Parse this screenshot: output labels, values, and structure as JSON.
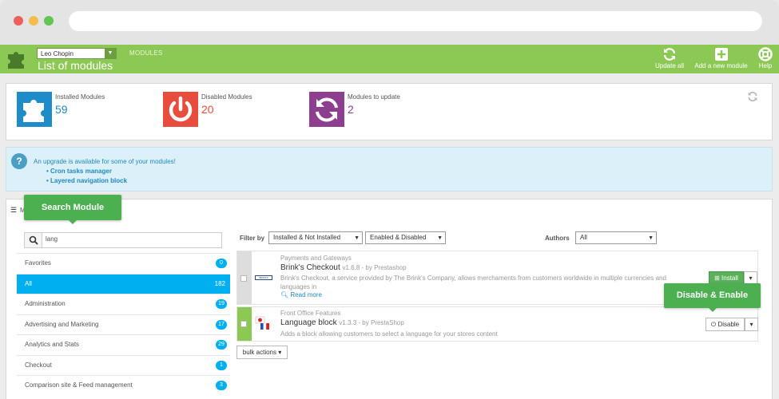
{
  "header": {
    "shop": "Leo Chopin",
    "breadcrumb": "MODULES",
    "title": "List of modules",
    "update_all": "Update all",
    "add_module": "Add a new module",
    "help": "Help"
  },
  "stats": [
    {
      "label": "Installed Modules",
      "value": "59",
      "color": "#1d8cc8"
    },
    {
      "label": "Disabled Modules",
      "value": "20",
      "color": "#e84c3d"
    },
    {
      "label": "Modules to update",
      "value": "2",
      "color": "#8e3e8e"
    }
  ],
  "alert": {
    "message": "An upgrade is available for some of your modules!",
    "items": [
      "Cron tasks manager",
      "Layered navigation block"
    ]
  },
  "tooltips": {
    "search": "Search Module",
    "disable_enable": "Disable & Enable"
  },
  "panel_heading": "M",
  "search": {
    "value": "lang"
  },
  "categories": [
    {
      "name": "Favorites",
      "count": "0"
    },
    {
      "name": "All",
      "count": "182"
    },
    {
      "name": "Administration",
      "count": "19"
    },
    {
      "name": "Advertising and Marketing",
      "count": "17"
    },
    {
      "name": "Analytics and Stats",
      "count": "29"
    },
    {
      "name": "Checkout",
      "count": "1"
    },
    {
      "name": "Comparison site & Feed management",
      "count": "3"
    }
  ],
  "filters": {
    "filter_by": "Filter by",
    "install_state": "Installed & Not Installed",
    "enable_state": "Enabled & Disabled",
    "authors_label": "Authors",
    "authors": "All"
  },
  "modules": [
    {
      "category": "Payments and Gateways",
      "name": "Brink's Checkout",
      "version": "v1.6.8 - by Prestashop",
      "description": "Brink's Checkout, a service provided by The Brink's Company, allows merchaments from customers worldwide in multiple currencies and languages in",
      "read_more": "Read more",
      "action": "Install",
      "logo_text": "BRINKS CHECKOUT"
    },
    {
      "category": "Front Office Features",
      "name": "Language block",
      "version": "v1.3.3 - by PrestaShop",
      "description": "Adds a block allowing customers to select a language for your stores content",
      "action": "Disable"
    }
  ],
  "bulk_actions": "bulk actions"
}
